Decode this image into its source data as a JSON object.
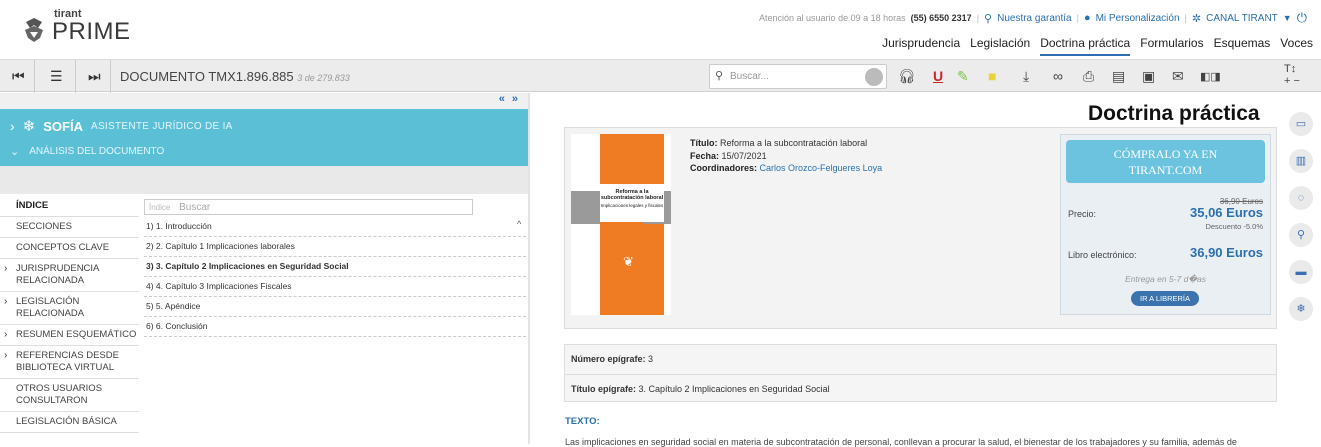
{
  "brand": {
    "small": "tirant",
    "big": "PRIME"
  },
  "topbar": {
    "attention": "Atención al usuario de 09 a 18 horas",
    "phone": "(55) 6550 2317",
    "guarantee": "Nuestra garantía",
    "personalization": "Mi Personalización",
    "channel": "CANAL TIRANT"
  },
  "nav": [
    "Jurisprudencia",
    "Legislación",
    "Doctrina práctica",
    "Formularios",
    "Esquemas",
    "Voces"
  ],
  "nav_active": "Doctrina práctica",
  "toolbar": {
    "document": "DOCUMENTO TMX1.896.885",
    "count": "3 de 279.833",
    "search_placeholder": "Buscar..."
  },
  "sofia": {
    "name": "SOFÍA",
    "subtitle": "ASISTENTE JURÍDICO DE IA",
    "analysis": "ANÁLISIS DEL DOCUMENTO"
  },
  "sidebar": [
    {
      "label": "ÍNDICE",
      "caret": false
    },
    {
      "label": "SECCIONES",
      "caret": false
    },
    {
      "label": "CONCEPTOS CLAVE",
      "caret": false
    },
    {
      "label": "JURISPRUDENCIA RELACIONADA",
      "caret": true
    },
    {
      "label": "LEGISLACIÓN RELACIONADA",
      "caret": true
    },
    {
      "label": "RESUMEN ESQUEMÁTICO",
      "caret": true
    },
    {
      "label": "REFERENCIAS DESDE BIBLIOTECA VIRTUAL",
      "caret": true
    },
    {
      "label": "OTROS USUARIOS CONSULTARON",
      "caret": false
    },
    {
      "label": "LEGISLACIÓN BÁSICA",
      "caret": false
    }
  ],
  "index": {
    "label": "Índice",
    "placeholder": "Buscar",
    "items": [
      "1) 1. Introducción",
      "2) 2. Capítulo 1 Implicaciones laborales",
      "3) 3. Capítulo 2 Implicaciones en Seguridad Social",
      "4) 4. Capítulo 3 Implicaciones Fiscales",
      "5) 5. Apéndice",
      "6) 6. Conclusión"
    ],
    "selected": 2
  },
  "page_title": "Doctrina práctica",
  "book": {
    "cover_title": "Reforma a la subcontratación laboral",
    "cover_subtitle": "Implicaciones legales y fiscales",
    "title_label": "Título:",
    "title": "Reforma a la subcontratación laboral",
    "date_label": "Fecha:",
    "date": "15/07/2021",
    "coord_label": "Coordinadores:",
    "coordinators": "Carlos Orozco-Felgueres Loya"
  },
  "purchase": {
    "button_line1": "CÓMPRALO YA EN",
    "button_line2": "TIRANT.COM",
    "old_price": "36,90 Euros",
    "price_label": "Precio:",
    "price": "35,06 Euros",
    "discount": "Descuento -5.0%",
    "ebook_label": "Libro electrónico:",
    "ebook_price": "36,90 Euros",
    "delivery": "Entrega en 5-7 d�as",
    "store_button": "IR A LIBRERÍA"
  },
  "epigraph": {
    "number_label": "Número epígrafe:",
    "number": "3",
    "title_label": "Título epígrafe:",
    "title": "3. Capítulo 2 Implicaciones en Seguridad Social"
  },
  "text_heading": "TEXTO:",
  "text_preview": "Las implicaciones en seguridad social en materia de subcontratación de personal, conllevan a procurar la salud, el bienestar de los trabajadores y su familia, además de",
  "colors": {
    "accent": "#2a6fb0",
    "sofia": "#5bbfd6",
    "cover": "#ef7b22"
  }
}
